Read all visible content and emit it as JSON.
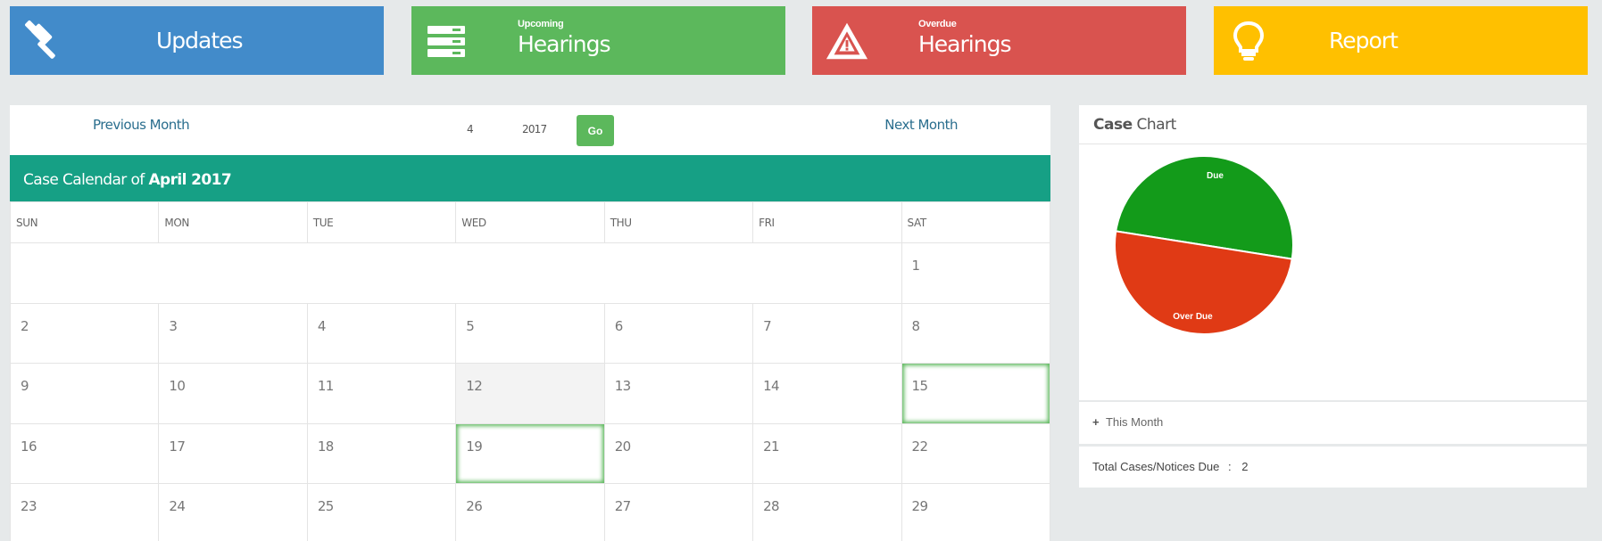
{
  "tiles": {
    "updates": {
      "label": "Updates",
      "icon": "gavel-icon",
      "color": "#428bca"
    },
    "upcoming": {
      "small": "Upcoming",
      "label": "Hearings",
      "icon": "server-icon",
      "color": "#5cb85c"
    },
    "overdue": {
      "small": "Overdue",
      "label": "Hearings",
      "icon": "warning-icon",
      "color": "#d9534f"
    },
    "report": {
      "label": "Report",
      "icon": "lightbulb-icon",
      "color": "#ffc000"
    }
  },
  "calendar": {
    "prev_label": "Previous Month",
    "next_label": "Next Month",
    "month_value": "4",
    "year_value": "2017",
    "go_label": "Go",
    "title_prefix": "Case Calendar of",
    "title_month": "April 2017",
    "header_color": "#16a085",
    "days": [
      "SUN",
      "MON",
      "TUE",
      "WED",
      "THU",
      "FRI",
      "SAT"
    ],
    "weeks": [
      [
        "",
        "",
        "",
        "",
        "",
        "",
        "1"
      ],
      [
        "2",
        "3",
        "4",
        "5",
        "6",
        "7",
        "8"
      ],
      [
        "9",
        "10",
        "11",
        "12",
        "13",
        "14",
        "15"
      ],
      [
        "16",
        "17",
        "18",
        "19",
        "20",
        "21",
        "22"
      ],
      [
        "23",
        "24",
        "25",
        "26",
        "27",
        "28",
        "29"
      ]
    ],
    "today": "12",
    "highlighted": [
      "15",
      "19"
    ]
  },
  "case_chart": {
    "title_bold": "Case",
    "title_rest": "Chart",
    "this_month_label": "This Month",
    "total_label": "Total Cases/Notices Due",
    "total_sep": ":",
    "total_value": "2"
  },
  "chart_data": {
    "type": "pie",
    "labels": [
      "Due",
      "Over Due"
    ],
    "values": [
      1,
      1
    ],
    "colors": [
      "#139b1a",
      "#e03a15"
    ]
  }
}
